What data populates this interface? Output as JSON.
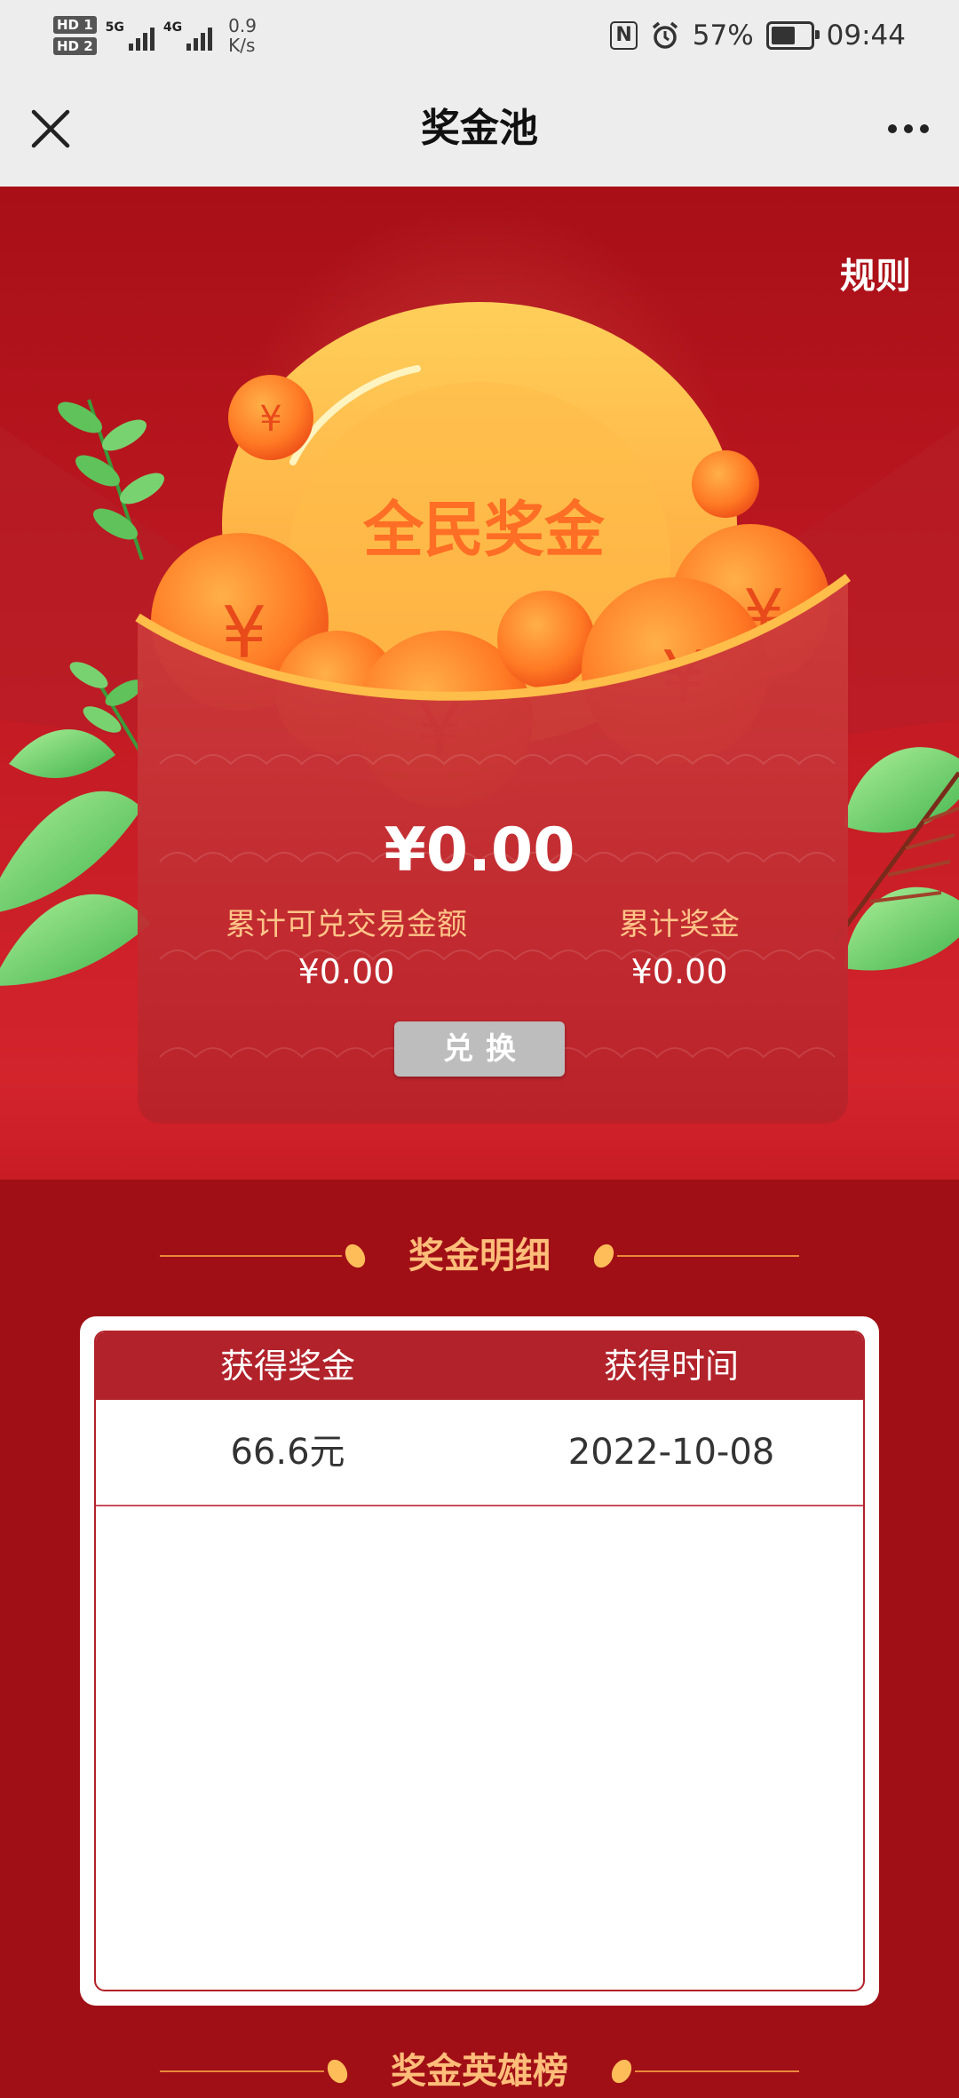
{
  "status_bar": {
    "sim1": "HD 1",
    "sim2": "HD 2",
    "net1": "5G",
    "net2": "4G",
    "speed_value": "0.9",
    "speed_unit": "K/s",
    "nfc": "N",
    "battery": "57%",
    "time": "09:44"
  },
  "title_bar": {
    "title": "奖金池"
  },
  "hero": {
    "rules_label": "规则",
    "envelope_title": "全民奖金",
    "total_amount": "¥0.00",
    "exchangeable_label": "累计可兑交易金额",
    "exchangeable_value": "¥0.00",
    "cumulative_label": "累计奖金",
    "cumulative_value": "¥0.00",
    "exchange_button": "兑换"
  },
  "details": {
    "heading": "奖金明细",
    "columns": [
      "获得奖金",
      "获得时间"
    ],
    "rows": [
      {
        "amount": "66.6元",
        "date": "2022-10-08"
      }
    ]
  },
  "leaderboard": {
    "heading": "奖金英雄榜"
  },
  "colors": {
    "brand_red": "#a00f16",
    "table_header": "#b2222a",
    "gold": "#ffbd7a",
    "button_disabled": "#bdbdbd"
  }
}
